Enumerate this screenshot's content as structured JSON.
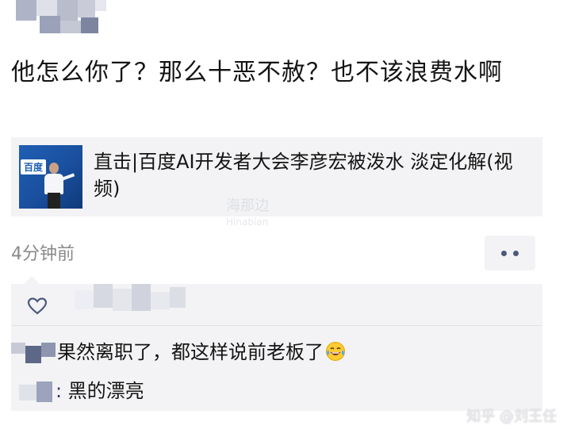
{
  "post": {
    "text": "他怎么你了？那么十恶不赦？也不该浪费水啊"
  },
  "link_card": {
    "title": "直击|百度AI开发者大会李彦宏被泼水 淡定化解(视频)",
    "thumbnail_logo": "百度"
  },
  "watermark": {
    "cn": "海那边",
    "en": "Hinabian"
  },
  "timestamp": "4分钟前",
  "more_button_icon": "more-dots-icon",
  "comments": [
    {
      "text": "果然离职了，都这样说前老板了",
      "emoji": "tears-of-joy-emoji"
    },
    {
      "separator": ":",
      "text": "黑的漂亮"
    }
  ],
  "site_watermark": "知乎 @刘王任",
  "colors": {
    "link_blue": "#4a5a7c",
    "card_bg": "#f3f3f5",
    "timestamp_gray": "#8a8a8a"
  }
}
